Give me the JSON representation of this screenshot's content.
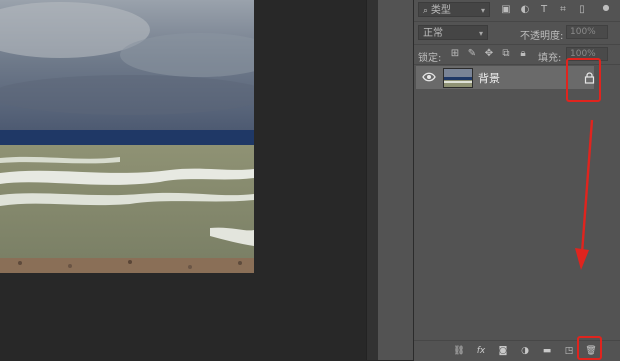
{
  "layers_panel": {
    "filter": {
      "value": "类型"
    },
    "blend_mode": {
      "value": "正常"
    },
    "opacity": {
      "label": "不透明度:",
      "value": "100%"
    },
    "lock": {
      "label": "锁定:"
    },
    "fill": {
      "label": "填充:",
      "value": "100%"
    },
    "layers": [
      {
        "name": "背景",
        "visible": true,
        "locked": true
      }
    ],
    "bottom_icons": [
      "link-icon",
      "fx-icon",
      "mask-icon",
      "adjustment-icon",
      "folder-icon",
      "new-layer-icon",
      "trash-icon"
    ]
  },
  "annotation_color": "#e0241e",
  "fx_label": "fx"
}
